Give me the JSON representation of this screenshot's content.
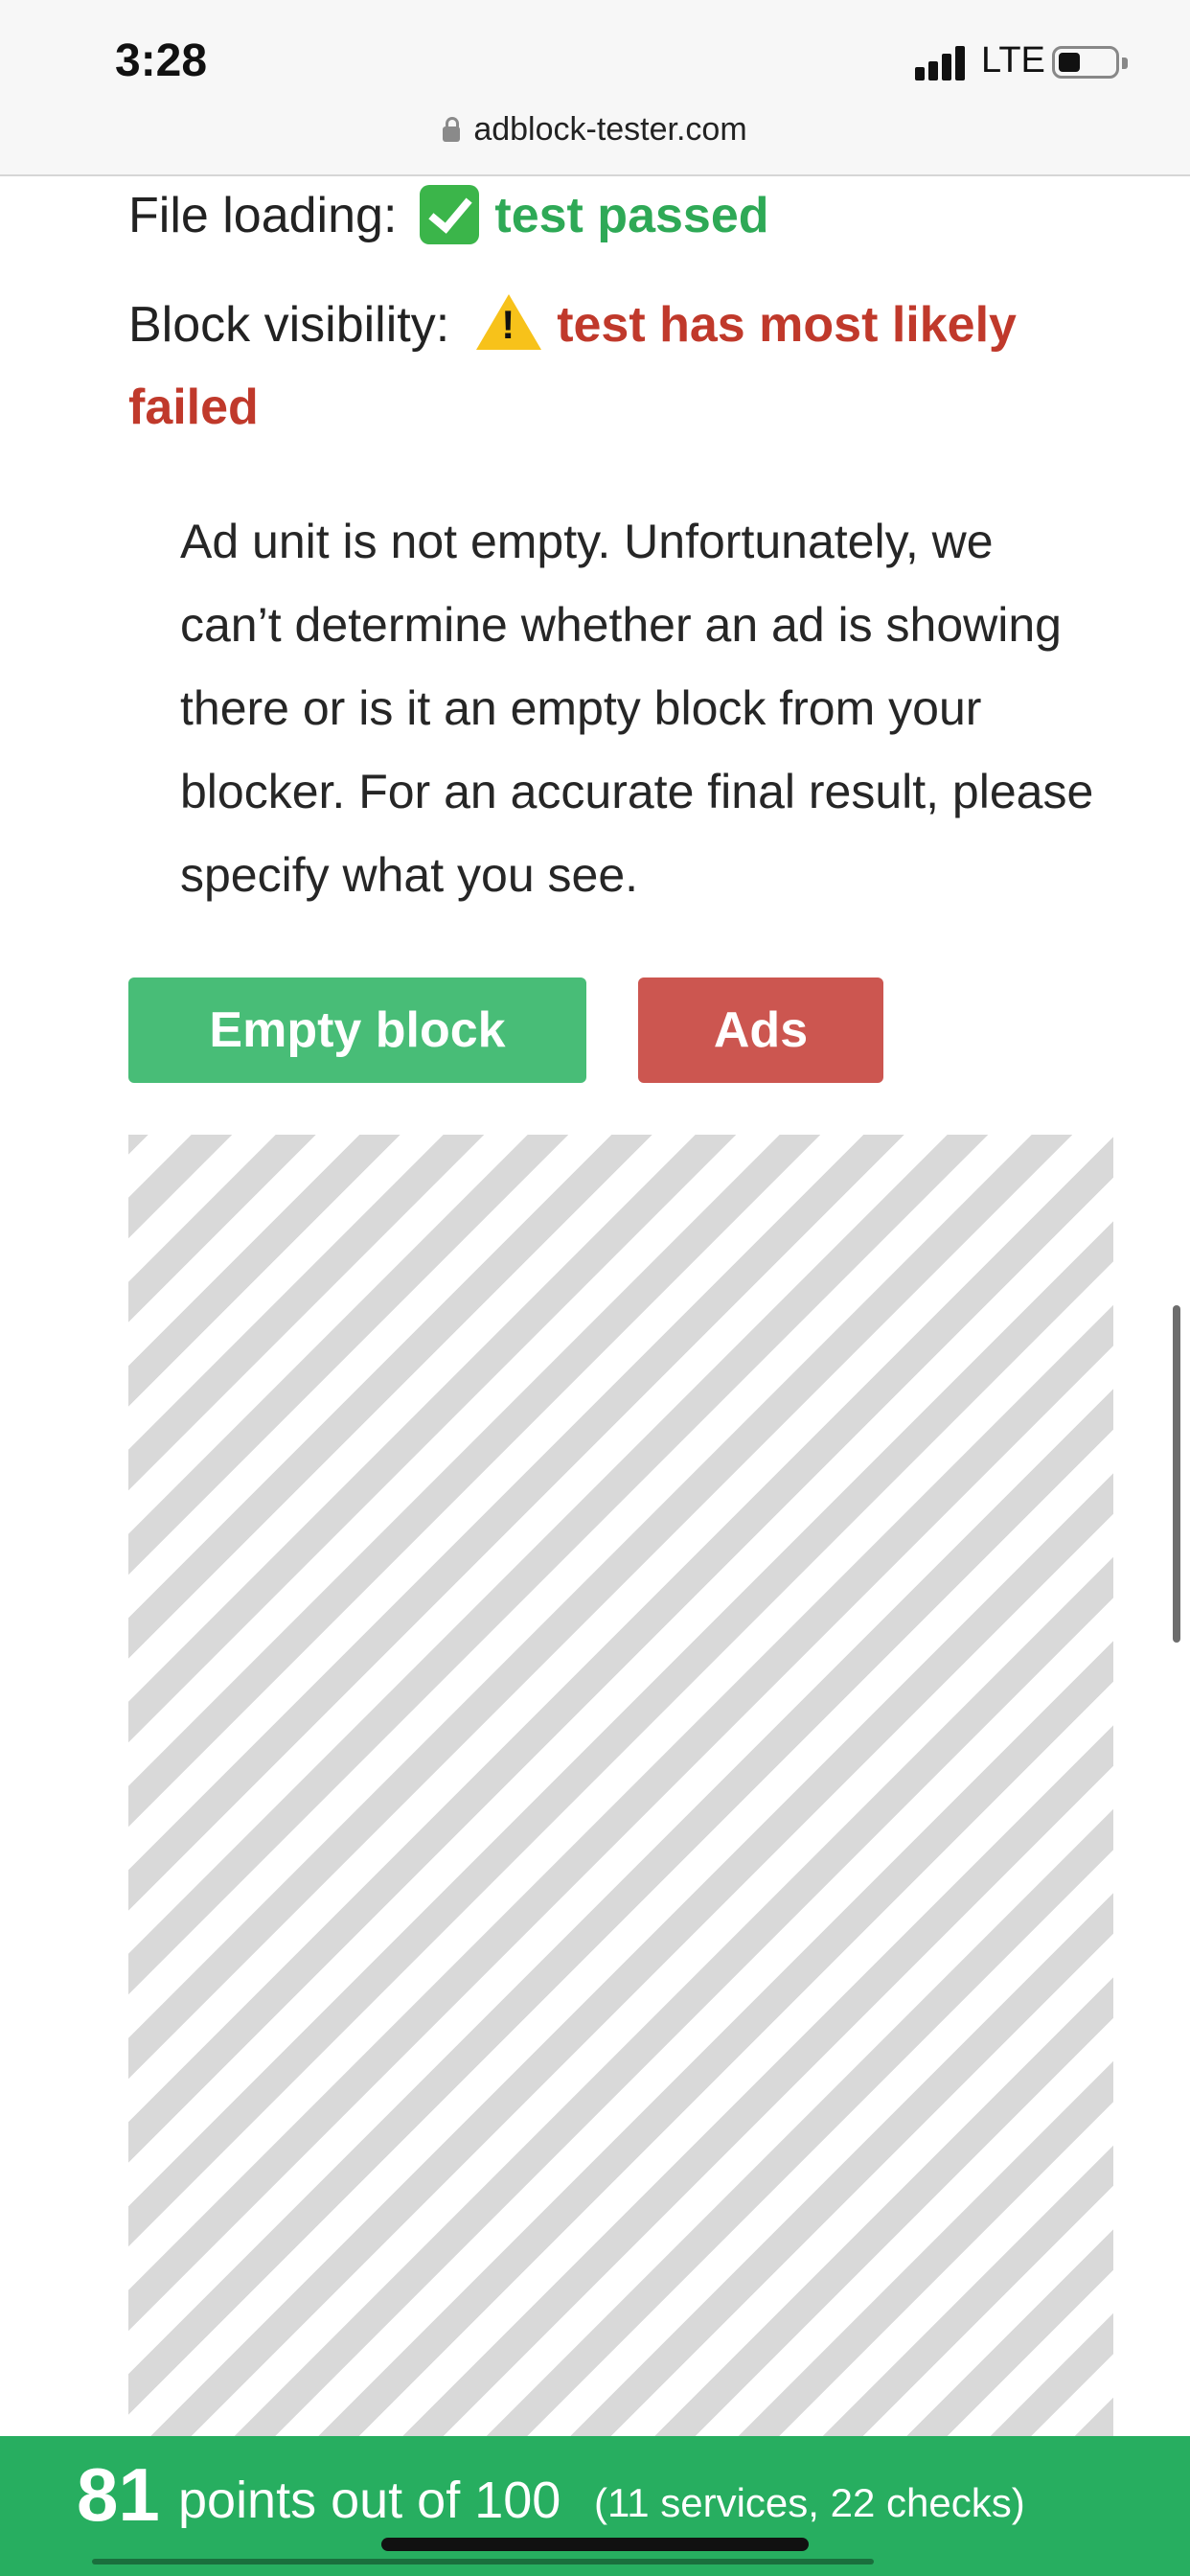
{
  "status_bar": {
    "time": "3:28",
    "network": "LTE"
  },
  "browser": {
    "url": "adblock-tester.com"
  },
  "results": {
    "file_loading": {
      "label": "File loading:",
      "status": "test passed",
      "icon": "check-mark-icon",
      "color": "#2ea956"
    },
    "block_visibility": {
      "label": "Block visibility:",
      "status_line1": "test has most likely",
      "status_line2": "failed",
      "icon": "warning-icon",
      "color": "#c0392b"
    }
  },
  "description": "Ad unit is not empty. Unfortunately, we can’t determine whether an ad is showing there or is it an empty block from your blocker. For an accurate final result, please specify what you see.",
  "buttons": {
    "empty_block": "Empty block",
    "ads": "Ads"
  },
  "score": {
    "points": "81",
    "text": "points out of 100",
    "detail": "(11 services, 22 checks)",
    "color": "#27ae60"
  }
}
